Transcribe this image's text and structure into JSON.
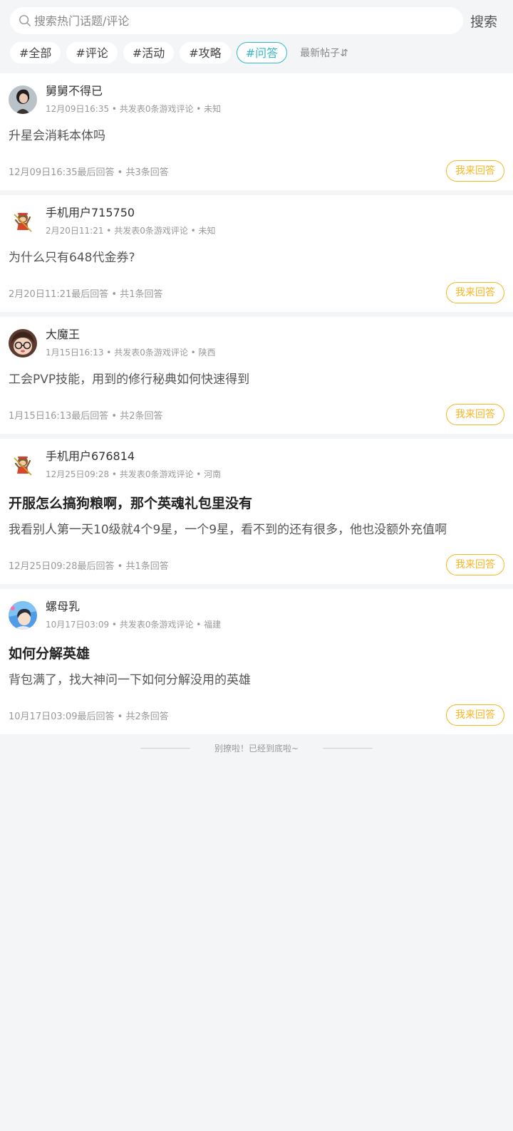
{
  "search": {
    "placeholder": "搜索热门话题/评论",
    "button_label": "搜索"
  },
  "tabs": [
    {
      "label": "#全部",
      "active": false
    },
    {
      "label": "#评论",
      "active": false
    },
    {
      "label": "#活动",
      "active": false
    },
    {
      "label": "#攻略",
      "active": false
    },
    {
      "label": "#问答",
      "active": true
    }
  ],
  "sort_label": "最新帖子⇵",
  "posts": [
    {
      "username": "舅舅不得已",
      "meta": "12月09日16:35 • 共发表0条游戏评论 • 未知",
      "title": "",
      "body": "升星会消耗本体吗",
      "footer": "12月09日16:35最后回答 • 共3条回答",
      "answer_label": "我来回答",
      "avatar": "photo-avatar"
    },
    {
      "username": "手机用户715750",
      "meta": "2月20日11:21 • 共发表0条游戏评论 • 未知",
      "title": "",
      "body": "为什么只有648代金券?",
      "footer": "2月20日11:21最后回答 • 共1条回答",
      "answer_label": "我来回答",
      "avatar": "monkey-avatar"
    },
    {
      "username": "大魔王",
      "meta": "1月15日16:13 • 共发表0条游戏评论 • 陕西",
      "title": "",
      "body": "工会PVP技能，用到的修行秘典如何快速得到",
      "footer": "1月15日16:13最后回答 • 共2条回答",
      "answer_label": "我来回答",
      "avatar": "cartoon-face-avatar"
    },
    {
      "username": "手机用户676814",
      "meta": "12月25日09:28 • 共发表0条游戏评论 • 河南",
      "title": "开服怎么搞狗粮啊，那个英魂礼包里没有",
      "body": "我看别人第一天10级就4个9星，一个9星，看不到的还有很多，他也没额外充值啊",
      "footer": "12月25日09:28最后回答 • 共1条回答",
      "answer_label": "我来回答",
      "avatar": "monkey-avatar"
    },
    {
      "username": "螺母乳",
      "meta": "10月17日03:09 • 共发表0条游戏评论 • 福建",
      "title": "如何分解英雄",
      "body": "背包满了，找大神问一下如何分解没用的英雄",
      "footer": "10月17日03:09最后回答 • 共2条回答",
      "answer_label": "我来回答",
      "avatar": "blue-anime-avatar"
    }
  ],
  "end_text": "别撩啦！已经到底啦~",
  "colors": {
    "accent": "#35b8c6",
    "answer": "#f5b623",
    "background": "#f4f5f7"
  }
}
